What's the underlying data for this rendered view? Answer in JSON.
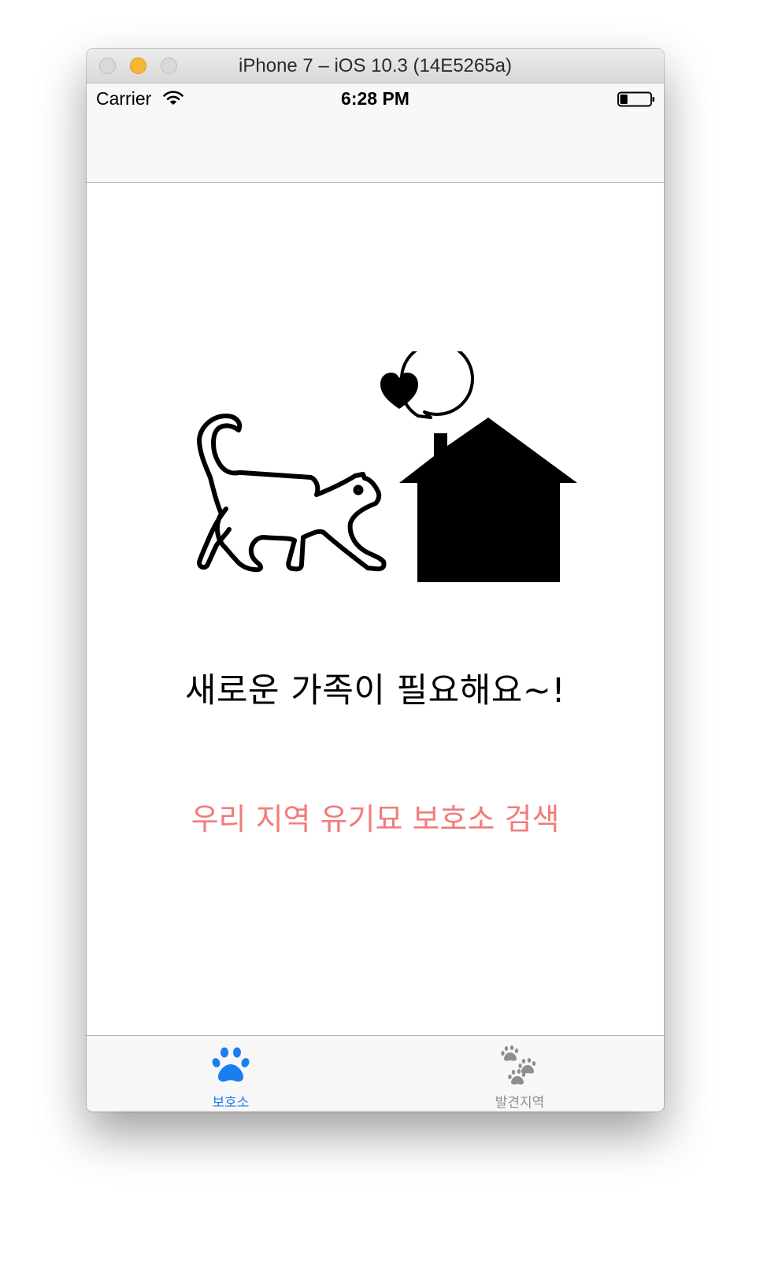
{
  "window": {
    "title": "iPhone 7 – iOS 10.3 (14E5265a)"
  },
  "status_bar": {
    "carrier": "Carrier",
    "time": "6:28 PM",
    "wifi_icon": "wifi-icon",
    "battery_icon": "battery-icon",
    "battery_level": 0.25
  },
  "main": {
    "illustration_icons": [
      "cat-icon",
      "house-icon",
      "heart-speech-bubble-icon"
    ],
    "heading": "새로운 가족이 필요해요~!",
    "search_button_label": "우리 지역 유기묘 보호소 검색",
    "search_button_color": "#f27b7b"
  },
  "tab_bar": {
    "tabs": [
      {
        "label": "보호소",
        "icon": "paw-icon",
        "selected": true,
        "color": "#1a7ef0"
      },
      {
        "label": "발견지역",
        "icon": "paw-prints-icon",
        "selected": false,
        "color": "#8e8e8e"
      }
    ]
  },
  "colors": {
    "accent": "#1a7ef0",
    "traffic_minimize": "#f7b733"
  }
}
